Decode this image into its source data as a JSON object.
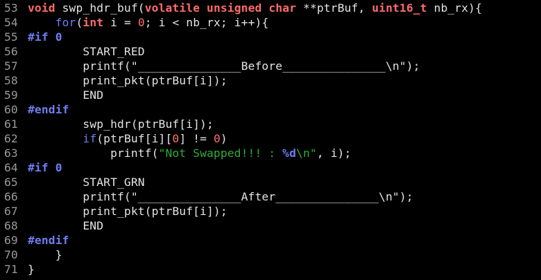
{
  "editor": {
    "lines": [
      {
        "number": "53",
        "tokens": [
          {
            "t": "void",
            "k": "type"
          },
          {
            "t": " swp_hdr_buf(",
            "k": "plain"
          },
          {
            "t": "volatile",
            "k": "type"
          },
          {
            "t": " ",
            "k": "plain"
          },
          {
            "t": "unsigned",
            "k": "type"
          },
          {
            "t": " ",
            "k": "plain"
          },
          {
            "t": "char",
            "k": "type"
          },
          {
            "t": " **ptrBuf, ",
            "k": "plain"
          },
          {
            "t": "uint16_t",
            "k": "type"
          },
          {
            "t": " nb_rx){",
            "k": "plain"
          }
        ]
      },
      {
        "number": "54",
        "tokens": [
          {
            "t": "    ",
            "k": "plain"
          },
          {
            "t": "for",
            "k": "keyword"
          },
          {
            "t": "(",
            "k": "plain"
          },
          {
            "t": "int",
            "k": "type"
          },
          {
            "t": " i = ",
            "k": "plain"
          },
          {
            "t": "0",
            "k": "number"
          },
          {
            "t": "; i < nb_rx; i++){",
            "k": "plain"
          }
        ]
      },
      {
        "number": "55",
        "tokens": [
          {
            "t": "#if ",
            "k": "preproc"
          },
          {
            "t": "0",
            "k": "preproc"
          }
        ]
      },
      {
        "number": "56",
        "tokens": [
          {
            "t": "        START_RED",
            "k": "plain"
          }
        ]
      },
      {
        "number": "57",
        "tokens": [
          {
            "t": "        printf(",
            "k": "plain"
          },
          {
            "t": "\"_______________Before_______________\\n\"",
            "k": "plain"
          },
          {
            "t": ");",
            "k": "plain"
          }
        ]
      },
      {
        "number": "58",
        "tokens": [
          {
            "t": "        print_pkt(ptrBuf[i]);",
            "k": "plain"
          }
        ]
      },
      {
        "number": "59",
        "tokens": [
          {
            "t": "        END",
            "k": "plain"
          }
        ]
      },
      {
        "number": "60",
        "tokens": [
          {
            "t": "#endif",
            "k": "preproc"
          }
        ]
      },
      {
        "number": "61",
        "tokens": [
          {
            "t": "        swp_hdr(ptrBuf[i]);",
            "k": "plain"
          }
        ]
      },
      {
        "number": "62",
        "tokens": [
          {
            "t": "        ",
            "k": "plain"
          },
          {
            "t": "if",
            "k": "keyword"
          },
          {
            "t": "(ptrBuf[i][",
            "k": "plain"
          },
          {
            "t": "0",
            "k": "number"
          },
          {
            "t": "] != ",
            "k": "plain"
          },
          {
            "t": "0",
            "k": "number"
          },
          {
            "t": ")",
            "k": "plain"
          }
        ]
      },
      {
        "number": "63",
        "tokens": [
          {
            "t": "            printf(",
            "k": "plain"
          },
          {
            "t": "\"Not Swapped!!! : ",
            "k": "string"
          },
          {
            "t": "%d",
            "k": "format"
          },
          {
            "t": "\\n\"",
            "k": "string"
          },
          {
            "t": ", i);",
            "k": "plain"
          }
        ]
      },
      {
        "number": "64",
        "tokens": [
          {
            "t": "#if ",
            "k": "preproc"
          },
          {
            "t": "0",
            "k": "preproc"
          }
        ]
      },
      {
        "number": "65",
        "tokens": [
          {
            "t": "        START_GRN",
            "k": "plain"
          }
        ]
      },
      {
        "number": "66",
        "tokens": [
          {
            "t": "        printf(",
            "k": "plain"
          },
          {
            "t": "\"_______________After_______________\\n\"",
            "k": "plain"
          },
          {
            "t": ");",
            "k": "plain"
          }
        ]
      },
      {
        "number": "67",
        "tokens": [
          {
            "t": "        print_pkt(ptrBuf[i]);",
            "k": "plain"
          }
        ]
      },
      {
        "number": "68",
        "tokens": [
          {
            "t": "        END",
            "k": "plain"
          }
        ]
      },
      {
        "number": "69",
        "tokens": [
          {
            "t": "#endif",
            "k": "preproc"
          }
        ]
      },
      {
        "number": "70",
        "tokens": [
          {
            "t": "    }",
            "k": "plain"
          }
        ]
      },
      {
        "number": "71",
        "tokens": [
          {
            "t": "}",
            "k": "plain"
          }
        ]
      }
    ]
  },
  "colors": {
    "background": "#000000",
    "line_number": "#9a9a9a",
    "plain": "#e4e4e4",
    "type_keyword": "#ff6b6b",
    "control_keyword": "#6f7df2",
    "preprocessor": "#6f7df2",
    "number_literal": "#ff6b6b",
    "string_literal": "#2fae35",
    "format_specifier": "#6f7df2"
  }
}
